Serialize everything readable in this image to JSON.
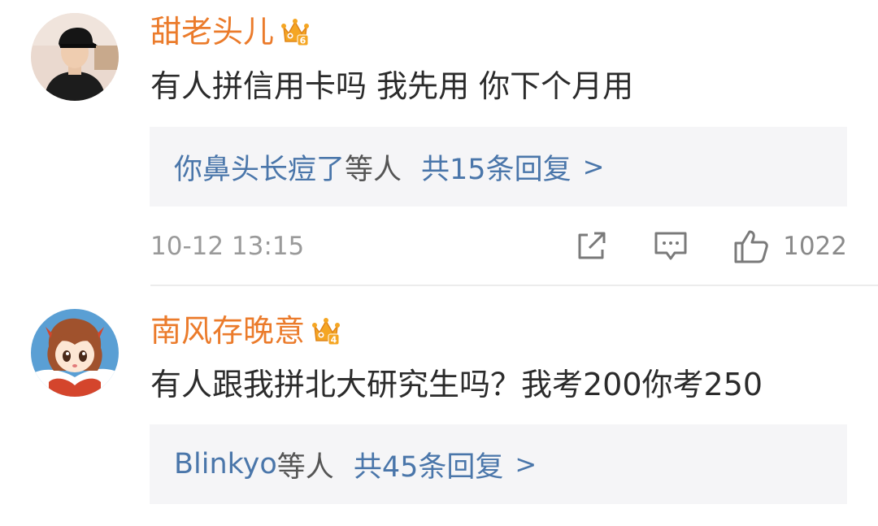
{
  "comments": [
    {
      "username": "甜老头儿",
      "vip_level": "6",
      "text": "有人拼信用卡吗 我先用 你下个月用",
      "reply": {
        "names": "你鼻头长痘了",
        "suffix": "等人",
        "count_text": "共15条回复",
        "chevron": ">"
      },
      "timestamp": "10-12 13:15",
      "likes": "1022"
    },
    {
      "username": "南风存晚意",
      "vip_level": "4",
      "text": "有人跟我拼北大研究生吗？我考200你考250",
      "reply": {
        "names": "Blinkyo",
        "suffix": "等人",
        "count_text": "共45条回复",
        "chevron": ">"
      }
    }
  ],
  "icons": {
    "vip": "crown-badge-icon",
    "share": "share-icon",
    "comment": "comment-icon",
    "like": "thumbs-up-icon"
  },
  "colors": {
    "username": "#eb7b2b",
    "link": "#4a76aa",
    "reply_bg": "#f5f5f7"
  }
}
